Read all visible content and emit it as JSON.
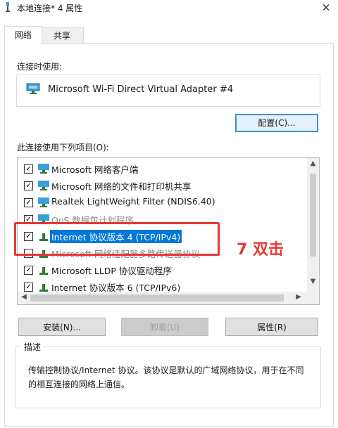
{
  "window": {
    "title": "本地连接* 4 属性",
    "close_glyph": "✕"
  },
  "tabs": [
    {
      "label": "网络",
      "active": true
    },
    {
      "label": "共享",
      "active": false
    }
  ],
  "connect_using": {
    "label": "连接时使用:",
    "adapter": "Microsoft Wi-Fi Direct Virtual Adapter #4",
    "configure_button": "配置(C)..."
  },
  "items": {
    "label": "此连接使用下列项目(O):",
    "rows": [
      {
        "label": "Microsoft 网络客户端",
        "checked": true,
        "icon": "network-client-icon"
      },
      {
        "label": "Microsoft 网络的文件和打印机共享",
        "checked": true,
        "icon": "network-service-icon"
      },
      {
        "label": "Realtek LightWeight Filter (NDIS6.40)",
        "checked": true,
        "icon": "network-filter-icon"
      },
      {
        "label": "QoS 数据包计划程序",
        "checked": true,
        "icon": "network-service-icon"
      },
      {
        "label": "Internet 协议版本 4 (TCP/IPv4)",
        "checked": true,
        "selected": true,
        "icon": "protocol-icon"
      },
      {
        "label": "Microsoft 网络适配器多路传送器协议",
        "checked": false,
        "icon": "protocol-icon"
      },
      {
        "label": "Microsoft LLDP 协议驱动程序",
        "checked": true,
        "icon": "protocol-icon"
      },
      {
        "label": "Internet 协议版本 6 (TCP/IPv6)",
        "checked": true,
        "icon": "protocol-icon"
      }
    ]
  },
  "buttons": {
    "install": "安装(N)...",
    "uninstall": "卸载(U)",
    "properties": "属性(R)"
  },
  "description": {
    "legend": "描述",
    "text": "传输控制协议/Internet 协议。该协议是默认的广域网络协议，用于在不同的相互连接的网络上通信。"
  },
  "annotation": {
    "text": "7 双击"
  },
  "colors": {
    "selection": "#0078d7",
    "annotation": "#e53935",
    "accent_border": "#3c8fdd"
  }
}
